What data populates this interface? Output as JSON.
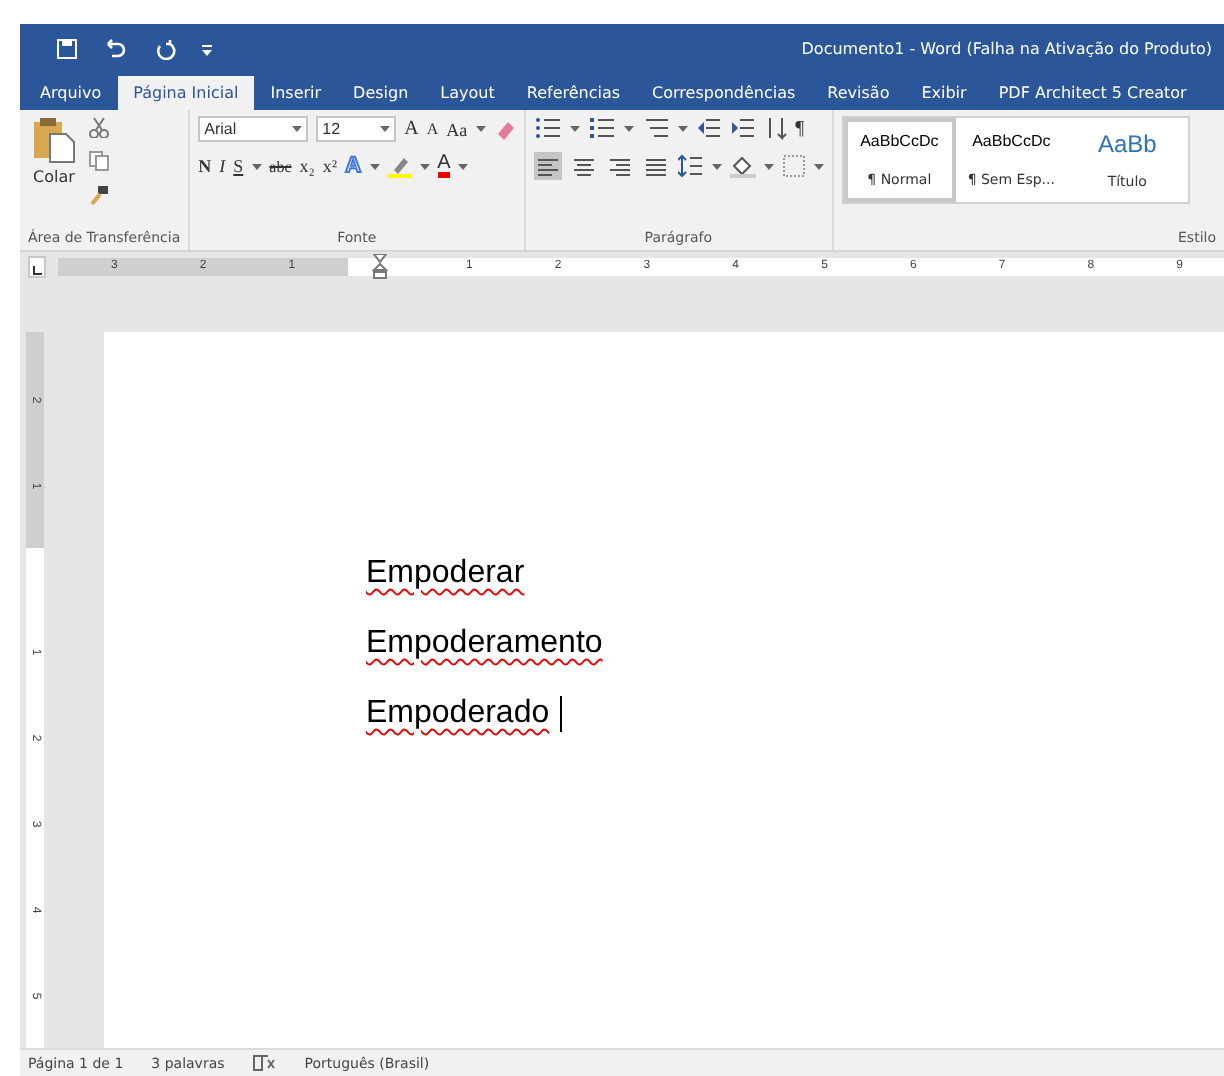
{
  "window": {
    "title": "Documento1 - Word (Falha na Ativação do Produto)"
  },
  "tabs": [
    {
      "label": "Arquivo",
      "selected": false
    },
    {
      "label": "Página Inicial",
      "selected": true
    },
    {
      "label": "Inserir",
      "selected": false
    },
    {
      "label": "Design",
      "selected": false
    },
    {
      "label": "Layout",
      "selected": false
    },
    {
      "label": "Referências",
      "selected": false
    },
    {
      "label": "Correspondências",
      "selected": false
    },
    {
      "label": "Revisão",
      "selected": false
    },
    {
      "label": "Exibir",
      "selected": false
    },
    {
      "label": "PDF Architect 5 Creator",
      "selected": false
    }
  ],
  "ribbon": {
    "clipboard": {
      "paste_label": "Colar",
      "group": "Área de Transferência"
    },
    "font": {
      "name": "Arial",
      "size": "12",
      "grow": "A",
      "shrink": "A",
      "case": "Aa",
      "bold": "N",
      "italic": "I",
      "underline": "S",
      "strike": "abc",
      "subscript": "x₂",
      "superscript": "x²",
      "text_effect": "A",
      "color_letter": "A",
      "group": "Fonte"
    },
    "paragraph": {
      "alignments": [
        {
          "kind": "left",
          "selected": true
        },
        {
          "kind": "center",
          "selected": false
        },
        {
          "kind": "right",
          "selected": false
        },
        {
          "kind": "justify",
          "selected": false
        }
      ],
      "pilcrow": "¶",
      "group": "Parágrafo"
    },
    "styles": {
      "items": [
        {
          "preview": "AaBbCcDc",
          "label": "¶ Normal",
          "kind": "body",
          "selected": true
        },
        {
          "preview": "AaBbCcDc",
          "label": "¶ Sem Esp...",
          "kind": "body",
          "selected": false
        },
        {
          "preview": "AaBb",
          "label": "Título",
          "kind": "heading",
          "selected": false
        }
      ],
      "group": "Estilo"
    }
  },
  "ruler": {
    "marks": [
      {
        "kind": "number",
        "label": "3"
      },
      {
        "kind": "number",
        "label": "2"
      },
      {
        "kind": "number",
        "label": "1"
      },
      {
        "kind": "indent"
      },
      {
        "kind": "number",
        "label": "1"
      },
      {
        "kind": "number",
        "label": "2"
      },
      {
        "kind": "number",
        "label": "3"
      },
      {
        "kind": "number",
        "label": "4"
      },
      {
        "kind": "number",
        "label": "5"
      },
      {
        "kind": "number",
        "label": "6"
      },
      {
        "kind": "number",
        "label": "7"
      },
      {
        "kind": "number",
        "label": "8"
      },
      {
        "kind": "number",
        "label": "9"
      }
    ]
  },
  "vertical_ruler": {
    "marks": [
      "2",
      "1",
      "1",
      "2",
      "3",
      "4",
      "5"
    ]
  },
  "document": {
    "lines": [
      {
        "text": "Empoderar",
        "misspelled": true,
        "caret": false
      },
      {
        "text": "Empoderamento",
        "misspelled": true,
        "caret": false
      },
      {
        "text": "Empoderado",
        "misspelled": true,
        "caret": true
      }
    ]
  },
  "status_bar": {
    "page": "Página 1 de 1",
    "words": "3 palavras",
    "language": "Português (Brasil)"
  }
}
